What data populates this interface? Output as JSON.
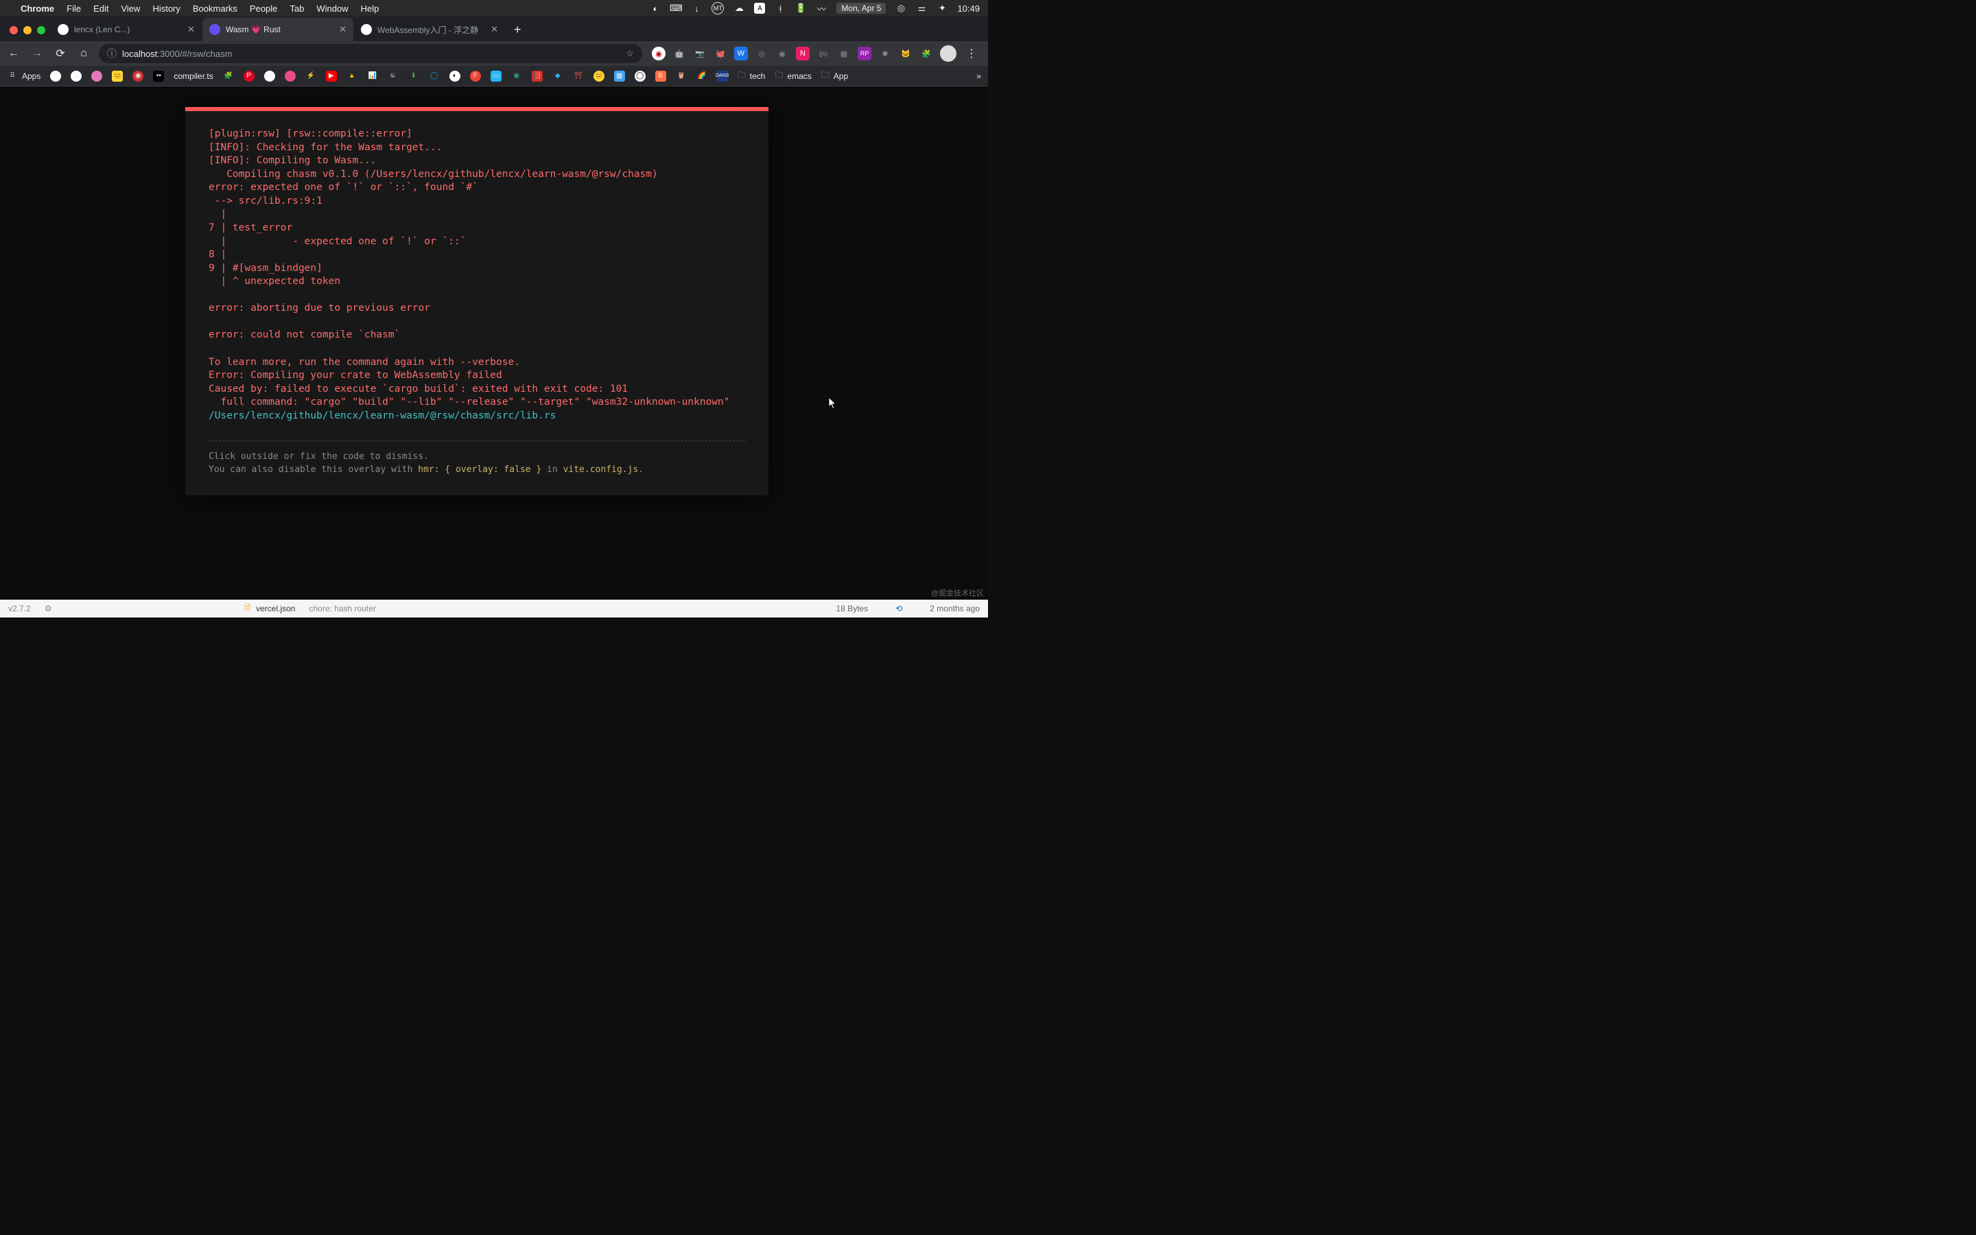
{
  "menubar": {
    "app": "Chrome",
    "items": [
      "File",
      "Edit",
      "View",
      "History",
      "Bookmarks",
      "People",
      "Tab",
      "Window",
      "Help"
    ],
    "date": "Mon, Apr 5",
    "time": "10:49"
  },
  "tabs": [
    {
      "title": "lencx (Len C...)",
      "active": false
    },
    {
      "title": "Wasm 💗 Rust",
      "active": true
    },
    {
      "title": "WebAssembly入门 - 浮之静",
      "active": false
    }
  ],
  "omnibox": {
    "host": "localhost",
    "rest": ":3000/#/rsw/chasm"
  },
  "bookmarks": {
    "apps": "Apps",
    "compiler": "compiler.ts",
    "folders": [
      "tech",
      "emacs",
      "App"
    ]
  },
  "error": {
    "body": "[plugin:rsw] [rsw::compile::error]\n[INFO]: Checking for the Wasm target...\n[INFO]: Compiling to Wasm...\n   Compiling chasm v0.1.0 (/Users/lencx/github/lencx/learn-wasm/@rsw/chasm)\nerror: expected one of `!` or `::`, found `#`\n --> src/lib.rs:9:1\n  |\n7 | test_error\n  |           - expected one of `!` or `::`\n8 |\n9 | #[wasm_bindgen]\n  | ^ unexpected token\n\nerror: aborting due to previous error\n\nerror: could not compile `chasm`\n\nTo learn more, run the command again with --verbose.\nError: Compiling your crate to WebAssembly failed\nCaused by: failed to execute `cargo build`: exited with exit code: 101\n  full command: \"cargo\" \"build\" \"--lib\" \"--release\" \"--target\" \"wasm32-unknown-unknown\"\n",
    "file": "/Users/lencx/github/lencx/learn-wasm/@rsw/chasm/src/lib.rs",
    "tip1": "Click outside or fix the code to dismiss.",
    "tip2a": "You can also disable this overlay with ",
    "tip2b": "hmr: { overlay: false }",
    "tip2c": " in ",
    "tip2d": "vite.config.js",
    "tip2e": "."
  },
  "bottom": {
    "version": "v2.7.2",
    "file": "vercel.json",
    "commit": "chore: hash router",
    "size": "18 Bytes",
    "age": "2 months ago"
  },
  "watermark": "@掘金技术社区"
}
